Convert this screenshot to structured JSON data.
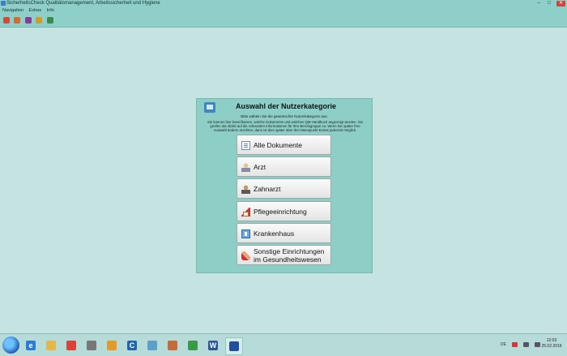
{
  "window": {
    "title": "SicherheitsCheck Qualitätsmanagement, Arbeitssicherheit und Hygiene",
    "controls": [
      "–",
      "□",
      "✕"
    ]
  },
  "menu": [
    "Navigation",
    "Extras",
    "Info"
  ],
  "toolbar": {
    "icons": [
      {
        "name": "home-icon",
        "color": "#d24b3a"
      },
      {
        "name": "clock-icon",
        "color": "#d6692f"
      },
      {
        "name": "user-icon",
        "color": "#8a3b98"
      },
      {
        "name": "refresh-icon",
        "color": "#d49b2a"
      },
      {
        "name": "settings-icon",
        "color": "#3b8a4a"
      }
    ]
  },
  "dialog": {
    "title": "Auswahl der Nutzerkategorie",
    "subtitle": "Bitte wählen Sie die gewünschte Nutzerkategorie aus:",
    "description": "Sie können hier beeinflussen, welche Dokumente und welches QM-Handbuch angezeigt werden. Sie greifen Sie direkt auf die relevanten Informationen für Ihre Berufsgruppe zu. Wenn Sie später Ihre Auswahl ändern möchten, dann ist dies später über den Menüpunkt Extras jederzeit möglich.",
    "buttons": [
      {
        "label": "Alle Dokumente",
        "icon": "documents-icon"
      },
      {
        "label": "Arzt",
        "icon": "doctor-icon"
      },
      {
        "label": "Zahnarzt",
        "icon": "dentist-icon"
      },
      {
        "label": "Pflegeeinrichtung",
        "icon": "care-home-icon"
      },
      {
        "label": "Krankenhaus",
        "icon": "hospital-icon"
      },
      {
        "label": "Sonstige Einrichtungen im Gesundheitswesen",
        "icon": "hands-icon"
      }
    ]
  },
  "taskbar": {
    "apps": [
      {
        "name": "internet-explorer-icon",
        "glyph": "e",
        "color": "#2a7fd4"
      },
      {
        "name": "file-explorer-icon",
        "glyph": "",
        "color": "#e2b84a"
      },
      {
        "name": "chrome-icon",
        "glyph": "",
        "color": "#d8433a"
      },
      {
        "name": "notepad-icon",
        "glyph": "",
        "color": "#777777"
      },
      {
        "name": "outlook-icon",
        "glyph": "",
        "color": "#e39a2c"
      },
      {
        "name": "c-app-icon",
        "glyph": "C",
        "color": "#2266aa"
      },
      {
        "name": "monitor-icon",
        "glyph": "",
        "color": "#5aa0c8"
      },
      {
        "name": "people-icon",
        "glyph": "",
        "color": "#c66a3c"
      },
      {
        "name": "network-icon",
        "glyph": "",
        "color": "#3a9a4a"
      },
      {
        "name": "word-icon",
        "glyph": "W",
        "color": "#2b579a"
      },
      {
        "name": "app-icon",
        "glyph": "",
        "color": "#1f4f9e"
      }
    ],
    "tray_language": "DE",
    "clock_time": "12:03",
    "clock_date": "25.02.2016"
  }
}
